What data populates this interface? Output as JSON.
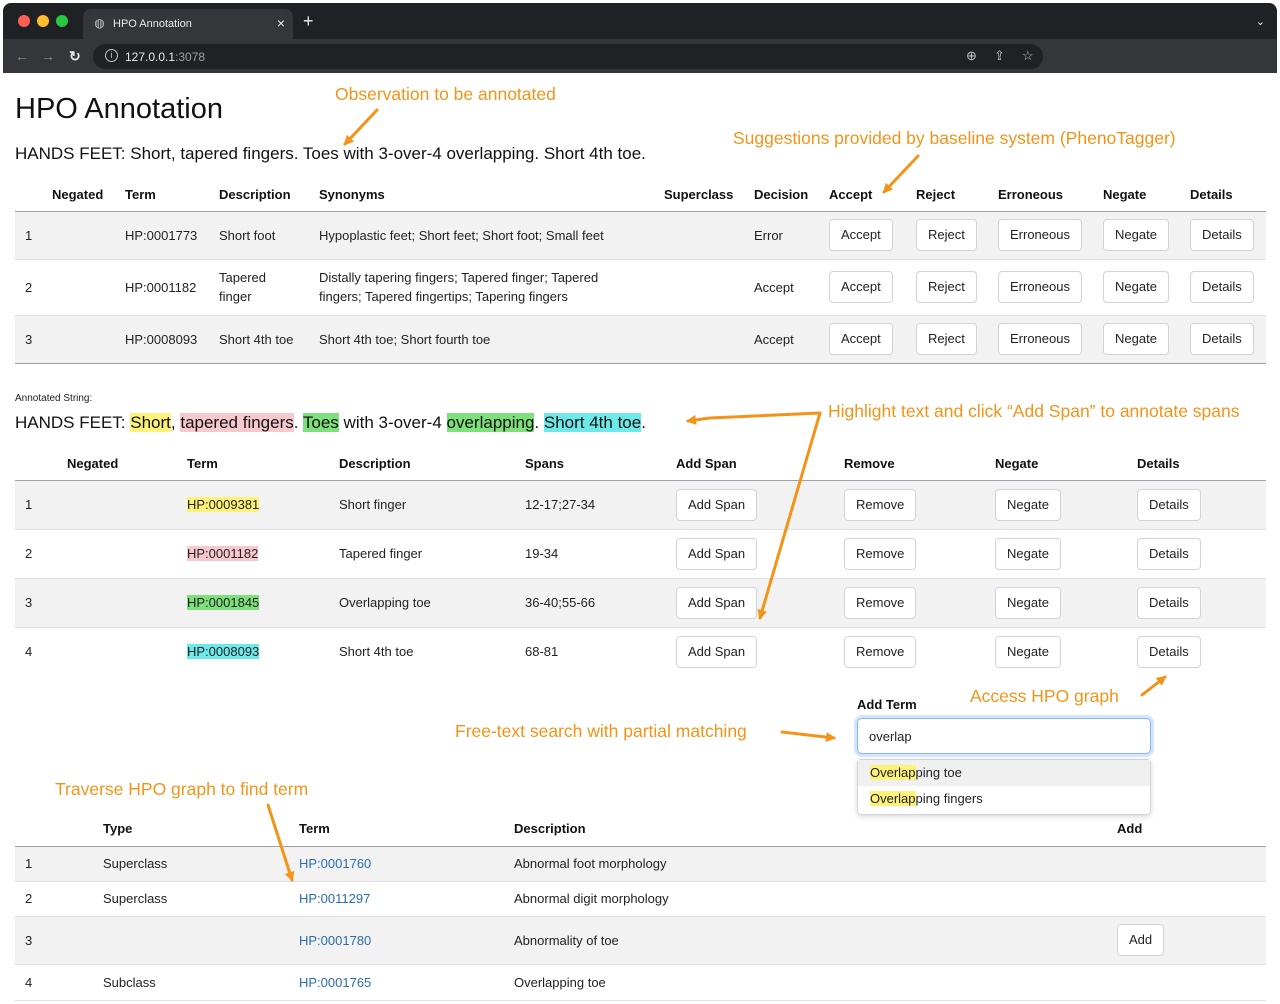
{
  "browser": {
    "tab_title": "HPO Annotation",
    "url_host": "127.0.0.1",
    "url_port": ":3078"
  },
  "page": {
    "title": "HPO Annotation",
    "observation": "HANDS FEET: Short, tapered fingers. Toes with 3-over-4 overlapping. Short 4th toe."
  },
  "suggestions": {
    "headers": [
      "Negated",
      "Term",
      "Description",
      "Synonyms",
      "Superclass",
      "Decision",
      "Accept",
      "Reject",
      "Erroneous",
      "Negate",
      "Details"
    ],
    "rows": [
      {
        "index": "1",
        "term": "HP:0001773",
        "description": "Short foot",
        "synonyms": "Hypoplastic feet; Short feet; Short foot; Small feet",
        "decision": "Error"
      },
      {
        "index": "2",
        "term": "HP:0001182",
        "description": "Tapered finger",
        "synonyms": "Distally tapering fingers; Tapered finger; Tapered fingers; Tapered fingertips; Tapering fingers",
        "decision": "Accept"
      },
      {
        "index": "3",
        "term": "HP:0008093",
        "description": "Short 4th toe",
        "synonyms": "Short 4th toe; Short fourth toe",
        "decision": "Accept"
      }
    ],
    "buttons": {
      "accept": "Accept",
      "reject": "Reject",
      "erroneous": "Erroneous",
      "negate": "Negate",
      "details": "Details"
    }
  },
  "annotated": {
    "label": "Annotated String:",
    "segments": {
      "prefix": "HANDS FEET: ",
      "short": "Short",
      "comma": ", ",
      "tapered": "tapered fingers",
      "dot1": ". ",
      "toes": "Toes",
      "with": " with 3-over-4 ",
      "overlapping": "overlapping",
      "dot2": ". ",
      "short4": "Short 4th toe",
      "dot3": "."
    }
  },
  "spans": {
    "headers": [
      "Negated",
      "Term",
      "Description",
      "Spans",
      "Add Span",
      "Remove",
      "Negate",
      "Details"
    ],
    "rows": [
      {
        "index": "1",
        "term": "HP:0009381",
        "description": "Short finger",
        "spans": "12-17;27-34",
        "color": "#fff27a"
      },
      {
        "index": "2",
        "term": "HP:0001182",
        "description": "Tapered finger",
        "spans": "19-34",
        "color": "#f7c9cf"
      },
      {
        "index": "3",
        "term": "HP:0001845",
        "description": "Overlapping toe",
        "spans": "36-40;55-66",
        "color": "#7ee07a"
      },
      {
        "index": "4",
        "term": "HP:0008093",
        "description": "Short 4th toe",
        "spans": "68-81",
        "color": "#6ee9ea"
      }
    ],
    "buttons": {
      "add_span": "Add Span",
      "remove": "Remove",
      "negate": "Negate",
      "details": "Details"
    }
  },
  "add_term": {
    "label": "Add Term",
    "value": "overlap",
    "suggestions": [
      {
        "match": "Overlap",
        "rest": "ping toe"
      },
      {
        "match": "Overlap",
        "rest": "ping fingers"
      }
    ]
  },
  "graph": {
    "headers": [
      "Type",
      "Term",
      "Description",
      "Add"
    ],
    "rows": [
      {
        "index": "1",
        "type": "Superclass",
        "term": "HP:0001760",
        "description": "Abnormal foot morphology"
      },
      {
        "index": "2",
        "type": "Superclass",
        "term": "HP:0011297",
        "description": "Abnormal digit morphology"
      },
      {
        "index": "3",
        "type": "",
        "term": "HP:0001780",
        "description": "Abnormality of toe",
        "add": "Add"
      },
      {
        "index": "4",
        "type": "Subclass",
        "term": "HP:0001765",
        "description": "Overlapping toe"
      }
    ]
  },
  "notes": {
    "observation": "Observation to be annotated",
    "suggestions": "Suggestions provided by baseline system (PhenoTagger)",
    "highlight": "Highlight text and click “Add Span” to annotate spans",
    "details": "Access HPO graph",
    "search": "Free-text search with partial matching",
    "graph": "Traverse HPO graph to find term"
  },
  "colors": {
    "annotation": "#f39419",
    "link": "#2a6db0"
  }
}
